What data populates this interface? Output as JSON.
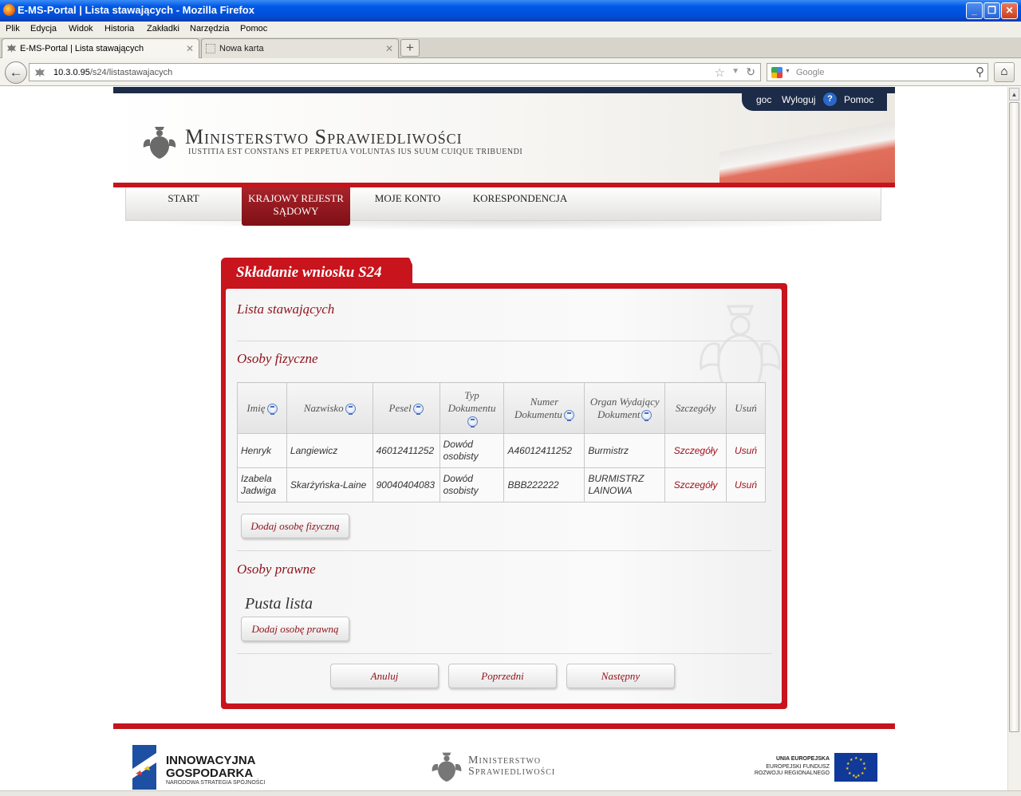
{
  "browser": {
    "window_title": "E-MS-Portal | Lista stawających - Mozilla Firefox",
    "menu": [
      "Plik",
      "Edycja",
      "Widok",
      "Historia",
      "Zakładki",
      "Narzędzia",
      "Pomoc"
    ],
    "tabs": [
      {
        "label": "E-MS-Portal | Lista stawających",
        "active": true
      },
      {
        "label": "Nowa karta",
        "active": false
      }
    ],
    "url_host": "10.3.0.95",
    "url_path": "/s24/listastawajacych",
    "search_placeholder": "Google"
  },
  "header": {
    "ministry_name": "Ministerstwo Sprawiedliwości",
    "motto": "Iustitia est constans et perpetua voluntas ius suum cuique tribuendi",
    "user": "goc",
    "logout": "Wyloguj",
    "help": "Pomoc"
  },
  "nav": [
    {
      "label": "START",
      "active": false
    },
    {
      "label": "KRAJOWY REJESTR SĄDOWY",
      "active": true
    },
    {
      "label": "MOJE KONTO",
      "active": false
    },
    {
      "label": "KORESPONDENCJA",
      "active": false
    }
  ],
  "panel": {
    "title": "Składanie wniosku S24",
    "list_title": "Lista stawających",
    "natural_title": "Osoby fizyczne",
    "legal_title": "Osoby prawne",
    "empty_list": "Pusta lista",
    "add_natural": "Dodaj osobę fizyczną",
    "add_legal": "Dodaj osobę prawną",
    "cancel": "Anuluj",
    "previous": "Poprzedni",
    "next": "Następny"
  },
  "table": {
    "headers": [
      "Imię",
      "Nazwisko",
      "Pesel",
      "Typ Dokumentu",
      "Numer Dokumentu",
      "Organ Wydający Dokument",
      "Szczegóły",
      "Usuń"
    ],
    "rows": [
      {
        "imie": "Henryk",
        "nazwisko": "Langiewicz",
        "pesel": "46012411252",
        "typ": "Dowód osobisty",
        "numer": "A46012411252",
        "organ": "Burmistrz",
        "details": "Szczegóły",
        "delete": "Usuń"
      },
      {
        "imie": "Izabela Jadwiga",
        "nazwisko": "Skarżyńska-Laine",
        "pesel": "90040404083",
        "typ": "Dowód osobisty",
        "numer": "BBB222222",
        "organ": "BURMISTRZ LAINOWA",
        "details": "Szczegóły",
        "delete": "Usuń"
      }
    ]
  },
  "footer": {
    "ig_line1": "INNOWACYJNA",
    "ig_line2": "GOSPODARKA",
    "ig_line3": "NARODOWA STRATEGIA SPÓJNOŚCI",
    "ms_line1": "Ministerstwo",
    "ms_line2": "Sprawiedliwości",
    "eu_line1": "UNIA EUROPEJSKA",
    "eu_line2": "EUROPEJSKI FUNDUSZ",
    "eu_line3": "ROZWOJU REGIONALNEGO"
  },
  "colors": {
    "accent": "#c4141c",
    "dark_navy": "#1c2b48",
    "link": "#a0101a"
  }
}
